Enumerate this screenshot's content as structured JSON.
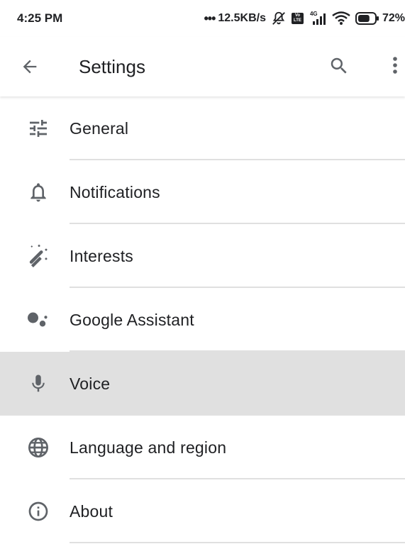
{
  "status_bar": {
    "time": "4:25 PM",
    "network_speed": "12.5KB/s",
    "network_type": "4G",
    "volte_label": "Vo LTE",
    "battery_percent": "72%",
    "battery_level": 0.72,
    "icons": [
      "dots-icon",
      "mute-icon",
      "volte-icon",
      "signal-icon",
      "wifi-icon",
      "battery-icon"
    ]
  },
  "app_bar": {
    "title": "Settings",
    "icons": [
      "back-arrow-icon",
      "search-icon",
      "more-vert-icon"
    ]
  },
  "settings": {
    "items": [
      {
        "label": "General",
        "icon": "tune-icon",
        "selected": false
      },
      {
        "label": "Notifications",
        "icon": "bell-icon",
        "selected": false
      },
      {
        "label": "Interests",
        "icon": "magic-wand-icon",
        "selected": false
      },
      {
        "label": "Google Assistant",
        "icon": "assistant-icon",
        "selected": false
      },
      {
        "label": "Voice",
        "icon": "mic-icon",
        "selected": true
      },
      {
        "label": "Language and region",
        "icon": "globe-icon",
        "selected": false
      },
      {
        "label": "About",
        "icon": "info-icon",
        "selected": false
      }
    ]
  },
  "colors": {
    "text": "#202124",
    "icon": "#5f6368",
    "selected_bg": "#e0e0e0",
    "divider": "#e0e0e0"
  }
}
